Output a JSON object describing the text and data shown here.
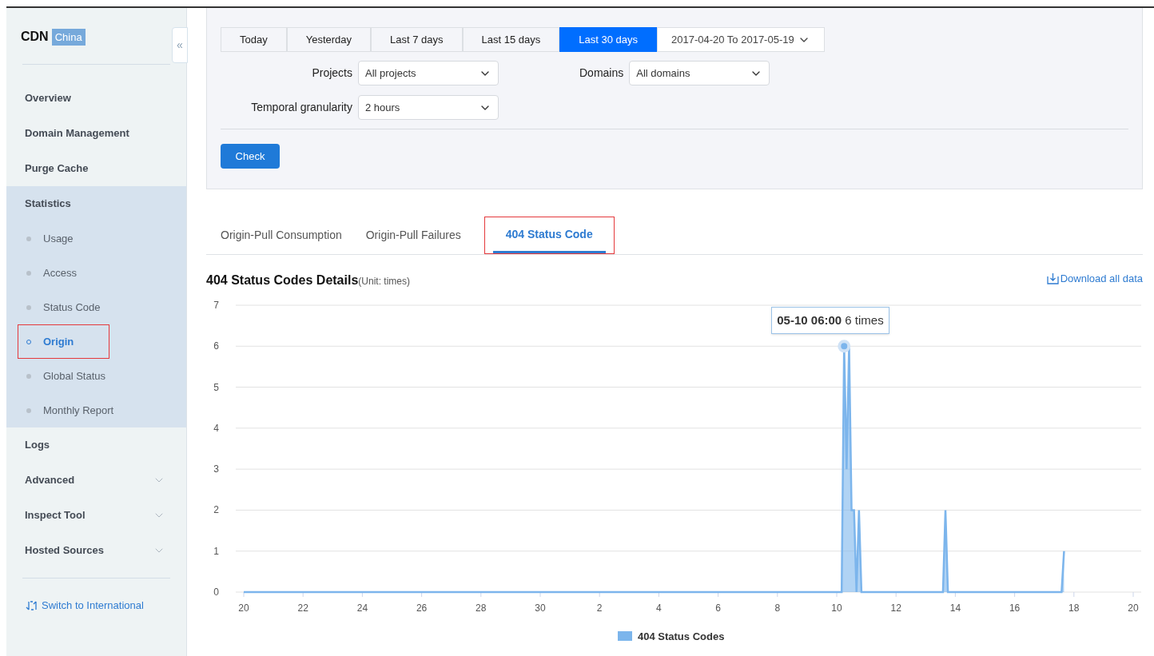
{
  "sidebar": {
    "brand": "CDN",
    "region_badge": "China",
    "collapse_glyph": "«",
    "items": [
      {
        "kind": "link",
        "label": "Overview"
      },
      {
        "kind": "link",
        "label": "Domain Management"
      },
      {
        "kind": "link",
        "label": "Purge Cache"
      },
      {
        "kind": "group",
        "label": "Statistics",
        "expanded": true,
        "children": [
          {
            "label": "Usage",
            "selected": false,
            "highlighted": false
          },
          {
            "label": "Access",
            "selected": false,
            "highlighted": false
          },
          {
            "label": "Status Code",
            "selected": false,
            "highlighted": false
          },
          {
            "label": "Origin",
            "selected": true,
            "highlighted": true
          },
          {
            "label": "Global Status",
            "selected": false,
            "highlighted": false
          },
          {
            "label": "Monthly Report",
            "selected": false,
            "highlighted": false
          }
        ]
      },
      {
        "kind": "link",
        "label": "Logs"
      },
      {
        "kind": "group",
        "label": "Advanced",
        "expanded": false
      },
      {
        "kind": "group",
        "label": "Inspect Tool",
        "expanded": false
      },
      {
        "kind": "group",
        "label": "Hosted Sources",
        "expanded": false
      }
    ],
    "switch_link": "Switch to International"
  },
  "filters": {
    "ranges": [
      {
        "label": "Today",
        "selected": false
      },
      {
        "label": "Yesterday",
        "selected": false
      },
      {
        "label": "Last 7 days",
        "selected": false
      },
      {
        "label": "Last 15 days",
        "selected": false
      },
      {
        "label": "Last 30 days",
        "selected": true
      }
    ],
    "date_range": "2017-04-20 To 2017-05-19",
    "projects": {
      "label": "Projects",
      "value": "All projects"
    },
    "domains": {
      "label": "Domains",
      "value": "All domains"
    },
    "granularity": {
      "label": "Temporal granularity",
      "value": "2 hours"
    },
    "check_button": "Check"
  },
  "tabs": [
    {
      "label": "Origin-Pull Consumption",
      "selected": false,
      "highlighted": false
    },
    {
      "label": "Origin-Pull Failures",
      "selected": false,
      "highlighted": false
    },
    {
      "label": "404 Status Code",
      "selected": true,
      "highlighted": true
    }
  ],
  "details": {
    "title": "404 Status Codes Details",
    "unit": "(Unit: times)",
    "download": "Download all data",
    "tooltip": {
      "time": "05-10 06:00",
      "value": "6 times"
    },
    "chart_data": {
      "type": "area",
      "categories": [
        "20",
        null,
        null,
        null,
        null,
        null,
        null,
        null,
        null,
        null,
        null,
        null,
        null,
        null,
        null,
        null,
        null,
        null,
        null,
        null,
        null,
        null,
        null,
        null,
        "22",
        null,
        null,
        null,
        null,
        null,
        null,
        null,
        null,
        null,
        null,
        null,
        null,
        null,
        null,
        null,
        null,
        null,
        null,
        null,
        null,
        null,
        null,
        null,
        "24",
        null,
        null,
        null,
        null,
        null,
        null,
        null,
        null,
        null,
        null,
        null,
        null,
        null,
        null,
        null,
        null,
        null,
        null,
        null,
        null,
        null,
        null,
        null,
        "26",
        null,
        null,
        null,
        null,
        null,
        null,
        null,
        null,
        null,
        null,
        null,
        null,
        null,
        null,
        null,
        null,
        null,
        null,
        null,
        null,
        null,
        null,
        null,
        "28",
        null,
        null,
        null,
        null,
        null,
        null,
        null,
        null,
        null,
        null,
        null,
        null,
        null,
        null,
        null,
        null,
        null,
        null,
        null,
        null,
        null,
        null,
        null,
        "30",
        null,
        null,
        null,
        null,
        null,
        null,
        null,
        null,
        null,
        null,
        null,
        null,
        null,
        null,
        null,
        null,
        null,
        null,
        null,
        null,
        null,
        null,
        null,
        "2",
        null,
        null,
        null,
        null,
        null,
        null,
        null,
        null,
        null,
        null,
        null,
        null,
        null,
        null,
        null,
        null,
        null,
        null,
        null,
        null,
        null,
        null,
        null,
        "4",
        null,
        null,
        null,
        null,
        null,
        null,
        null,
        null,
        null,
        null,
        null,
        null,
        null,
        null,
        null,
        null,
        null,
        null,
        null,
        null,
        null,
        null,
        null,
        "6",
        null,
        null,
        null,
        null,
        null,
        null,
        null,
        null,
        null,
        null,
        null,
        null,
        null,
        null,
        null,
        null,
        null,
        null,
        null,
        null,
        null,
        null,
        null,
        "8",
        null,
        null,
        null,
        null,
        null,
        null,
        null,
        null,
        null,
        null,
        null,
        null,
        null,
        null,
        null,
        null,
        null,
        null,
        null,
        null,
        null,
        null,
        null,
        "10",
        null,
        null,
        null,
        null,
        null,
        null,
        null,
        null,
        null,
        null,
        null,
        null,
        null,
        null,
        null,
        null,
        null,
        null,
        null,
        null,
        null,
        null,
        null,
        "12",
        null,
        null,
        null,
        null,
        null,
        null,
        null,
        null,
        null,
        null,
        null,
        null,
        null,
        null,
        null,
        null,
        null,
        null,
        null,
        null,
        null,
        null,
        null,
        "14",
        null,
        null,
        null,
        null,
        null,
        null,
        null,
        null,
        null,
        null,
        null,
        null,
        null,
        null,
        null,
        null,
        null,
        null,
        null,
        null,
        null,
        null,
        null,
        "16",
        null,
        null,
        null,
        null,
        null,
        null,
        null,
        null,
        null,
        null,
        null,
        null,
        null,
        null,
        null,
        null,
        null,
        null,
        null,
        null,
        null,
        null,
        null,
        "18",
        null,
        null,
        null,
        null,
        null,
        null,
        null,
        null,
        null,
        null,
        null,
        null,
        null,
        null,
        null,
        null,
        null,
        null,
        null,
        null,
        null,
        null,
        null,
        "20"
      ],
      "series": [
        {
          "name": "404 Status Codes",
          "color": "#7cb5ec",
          "values": [
            0,
            0,
            0,
            0,
            0,
            0,
            0,
            0,
            0,
            0,
            0,
            0,
            0,
            0,
            0,
            0,
            0,
            0,
            0,
            0,
            0,
            0,
            0,
            0,
            0,
            0,
            0,
            0,
            0,
            0,
            0,
            0,
            0,
            0,
            0,
            0,
            0,
            0,
            0,
            0,
            0,
            0,
            0,
            0,
            0,
            0,
            0,
            0,
            0,
            0,
            0,
            0,
            0,
            0,
            0,
            0,
            0,
            0,
            0,
            0,
            0,
            0,
            0,
            0,
            0,
            0,
            0,
            0,
            0,
            0,
            0,
            0,
            0,
            0,
            0,
            0,
            0,
            0,
            0,
            0,
            0,
            0,
            0,
            0,
            0,
            0,
            0,
            0,
            0,
            0,
            0,
            0,
            0,
            0,
            0,
            0,
            0,
            0,
            0,
            0,
            0,
            0,
            0,
            0,
            0,
            0,
            0,
            0,
            0,
            0,
            0,
            0,
            0,
            0,
            0,
            0,
            0,
            0,
            0,
            0,
            0,
            0,
            0,
            0,
            0,
            0,
            0,
            0,
            0,
            0,
            0,
            0,
            0,
            0,
            0,
            0,
            0,
            0,
            0,
            0,
            0,
            0,
            0,
            0,
            0,
            0,
            0,
            0,
            0,
            0,
            0,
            0,
            0,
            0,
            0,
            0,
            0,
            0,
            0,
            0,
            0,
            0,
            0,
            0,
            0,
            0,
            0,
            0,
            0,
            0,
            0,
            0,
            0,
            0,
            0,
            0,
            0,
            0,
            0,
            0,
            0,
            0,
            0,
            0,
            0,
            0,
            0,
            0,
            0,
            0,
            0,
            0,
            0,
            0,
            0,
            0,
            0,
            0,
            0,
            0,
            0,
            0,
            0,
            0,
            0,
            0,
            0,
            0,
            0,
            0,
            0,
            0,
            0,
            0,
            0,
            0,
            0,
            0,
            0,
            0,
            0,
            0,
            0,
            0,
            0,
            0,
            0,
            0,
            0,
            0,
            0,
            0,
            0,
            0,
            0,
            0,
            0,
            0,
            0,
            0,
            0,
            0,
            0,
            6,
            3,
            6,
            2,
            2,
            0,
            2,
            0,
            0,
            0,
            0,
            0,
            0,
            0,
            0,
            0,
            0,
            0,
            0,
            0,
            0,
            0,
            0,
            0,
            0,
            0,
            0,
            0,
            0,
            0,
            0,
            0,
            0,
            0,
            0,
            0,
            0,
            0,
            0,
            0,
            0,
            2,
            0,
            0,
            0,
            0,
            0,
            0,
            0,
            0,
            0,
            0,
            0,
            0,
            0,
            0,
            0,
            0,
            0,
            0,
            0,
            0,
            0,
            0,
            0,
            0,
            0,
            0,
            0,
            0,
            0,
            0,
            0,
            0,
            0,
            0,
            0,
            0,
            0,
            0,
            0,
            0,
            0,
            0,
            0,
            0,
            0,
            0,
            0,
            1,
            null,
            null,
            null,
            null,
            null,
            null,
            null,
            null,
            null,
            null,
            null,
            null,
            null,
            null,
            null,
            null,
            null,
            null,
            null,
            null,
            null,
            null,
            null,
            null,
            null,
            null,
            null,
            null
          ]
        }
      ],
      "grid": true,
      "ylim": [
        0,
        7
      ],
      "yticks": [
        0,
        1,
        2,
        3,
        4,
        5,
        6,
        7
      ]
    }
  }
}
